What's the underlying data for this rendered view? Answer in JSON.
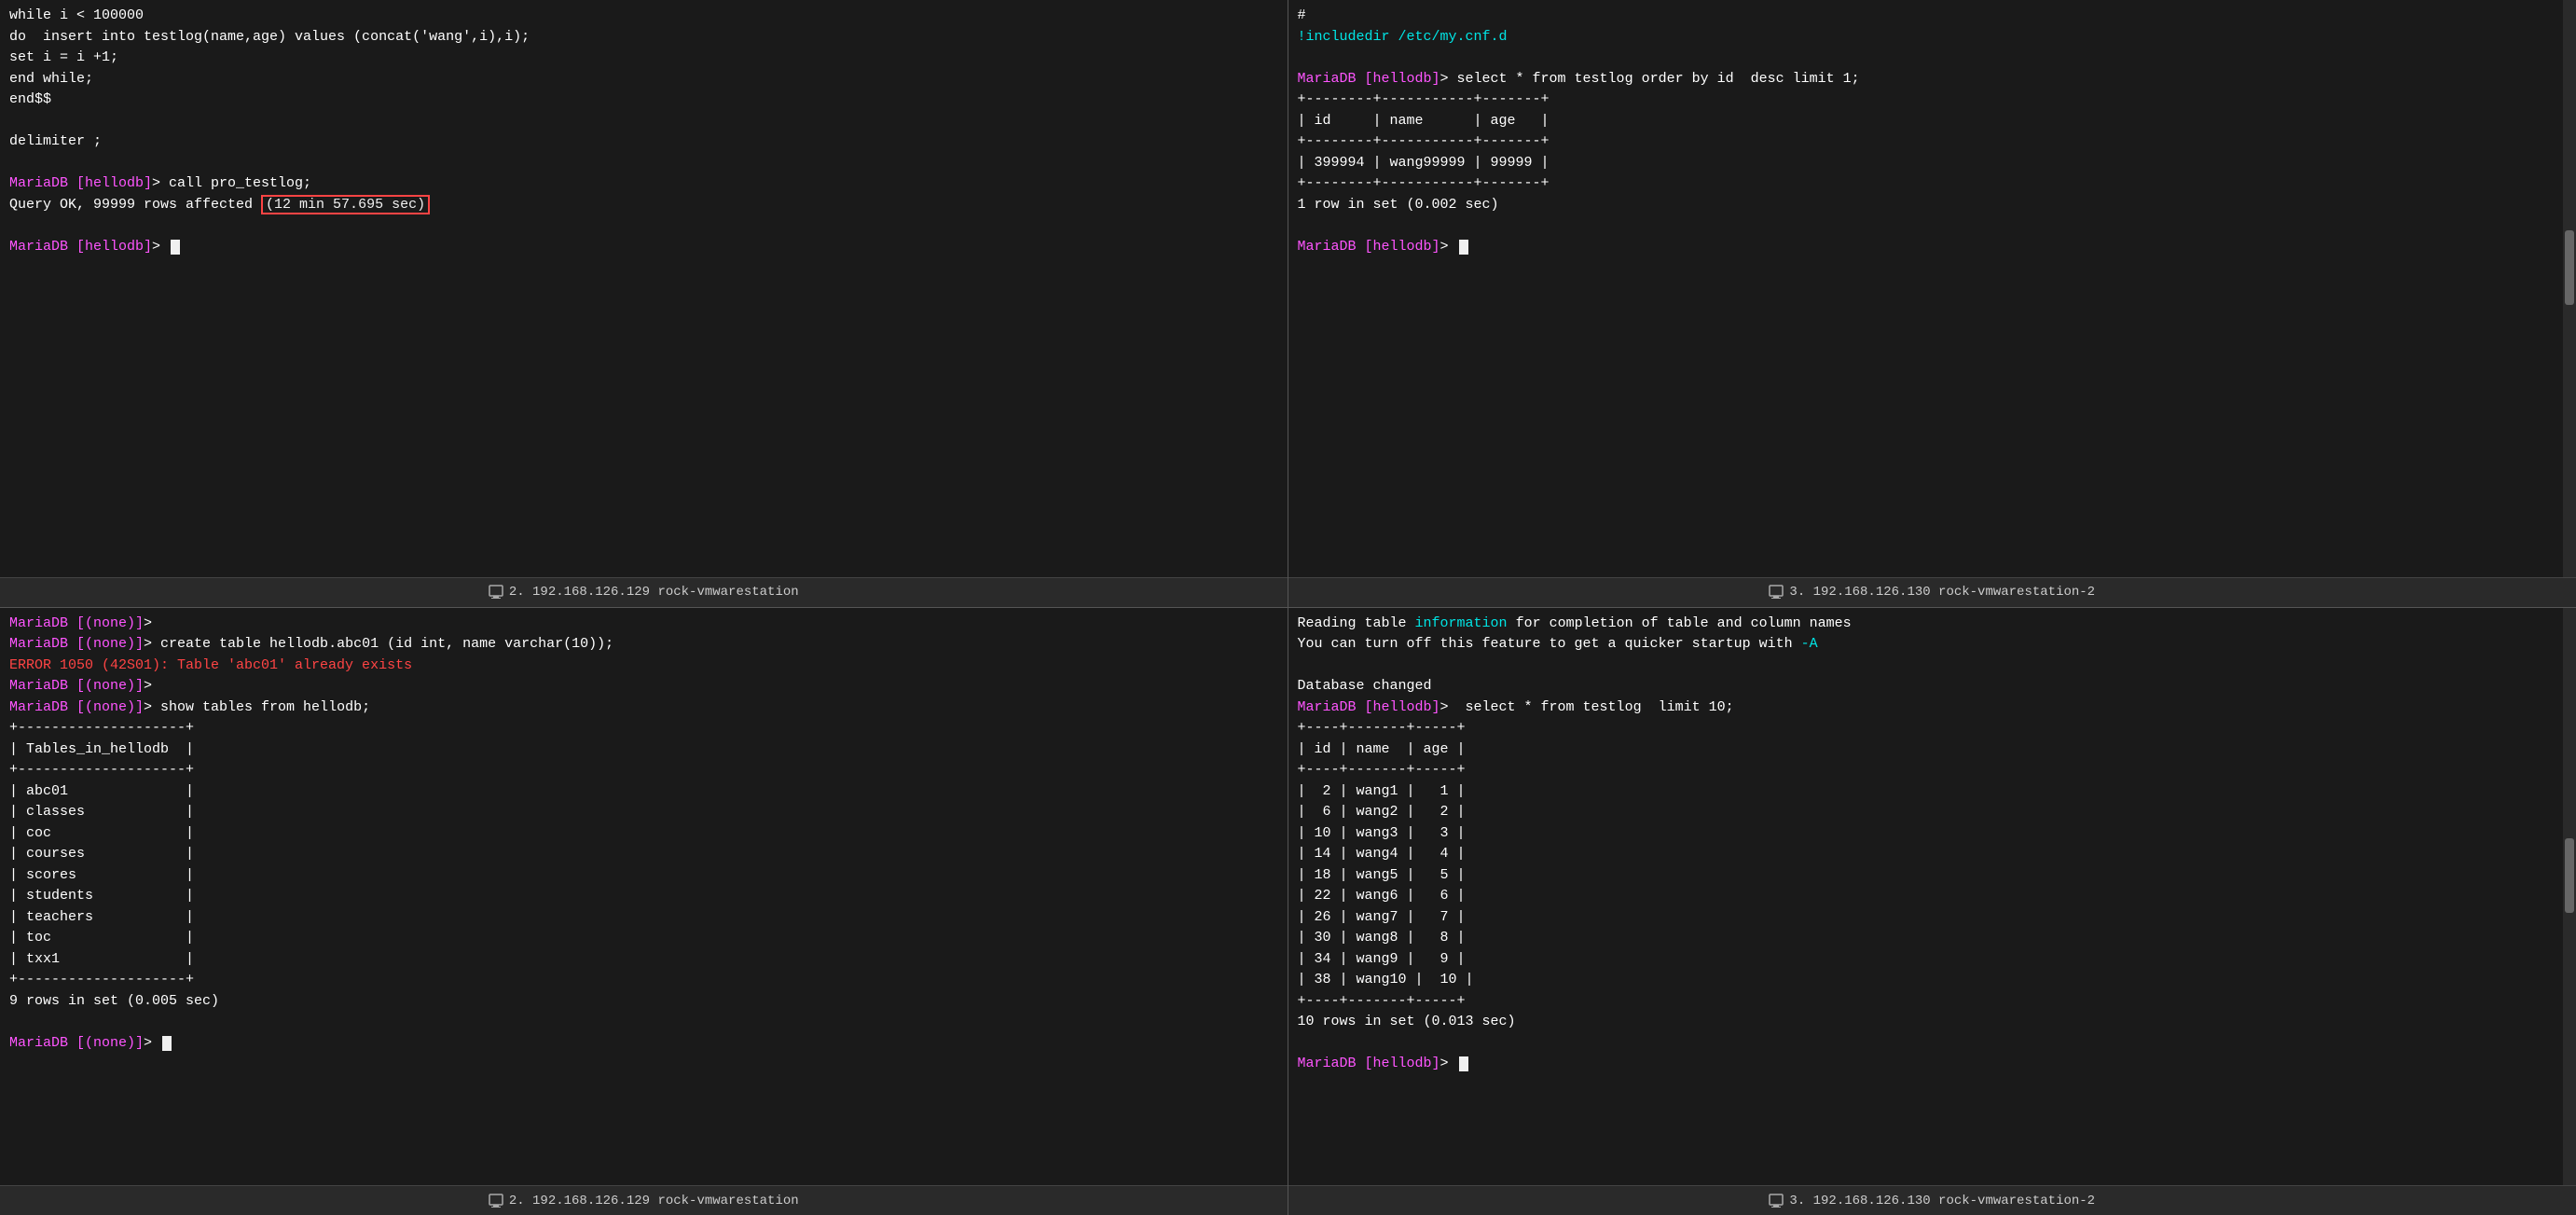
{
  "panels": {
    "top_left": {
      "tab": "2. 192.168.126.129 rock-vmwarestation",
      "content": [
        {
          "type": "normal",
          "text": "while i < 100000"
        },
        {
          "type": "normal",
          "text": "do  insert into testlog(name,age) values (concat('wang',i),i);"
        },
        {
          "type": "normal",
          "text": "set i = i +1;"
        },
        {
          "type": "normal",
          "text": "end while;"
        },
        {
          "type": "normal",
          "text": "end$$"
        },
        {
          "type": "blank"
        },
        {
          "type": "normal",
          "text": "delimiter ;"
        },
        {
          "type": "blank"
        },
        {
          "type": "prompt",
          "prompt": "MariaDB [hellodb]>",
          "cmd": " call pro_testlog;"
        },
        {
          "type": "query_ok",
          "text": "Query OK, 99999 rows affected ",
          "highlight": "(12 min 57.695 sec)"
        },
        {
          "type": "blank"
        },
        {
          "type": "prompt_cursor",
          "prompt": "MariaDB [hellodb]>"
        }
      ]
    },
    "top_right": {
      "tab": "3. 192.168.126.130 rock-vmwarestation-2",
      "content": [
        {
          "type": "normal",
          "text": "#"
        },
        {
          "type": "cyan",
          "text": "!includedir /etc/my.cnf.d"
        },
        {
          "type": "blank"
        },
        {
          "type": "prompt",
          "prompt": "MariaDB [hellodb]>",
          "cmd": " select * from testlog order by id  desc limit 1;"
        },
        {
          "type": "table_line",
          "text": "+--------+-----------+-------+"
        },
        {
          "type": "table_line",
          "text": "| id     | name      | age   |"
        },
        {
          "type": "table_line",
          "text": "+--------+-----------+-------+"
        },
        {
          "type": "table_line",
          "text": "| 399994 | wang99999 | 99999 |"
        },
        {
          "type": "table_line",
          "text": "+--------+-----------+-------+"
        },
        {
          "type": "normal",
          "text": "1 row in set (0.002 sec)"
        },
        {
          "type": "blank"
        },
        {
          "type": "prompt_cursor",
          "prompt": "MariaDB [hellodb]>"
        }
      ]
    },
    "bottom_left": {
      "tab": "2. 192.168.126.129 rock-vmwarestation",
      "content": [
        {
          "type": "prompt",
          "prompt": "MariaDB [(none)]>",
          "cmd": ""
        },
        {
          "type": "prompt",
          "prompt": "MariaDB [(none)]>",
          "cmd": " create table hellodb.abc01 (id int, name varchar(10));"
        },
        {
          "type": "error",
          "text": "ERROR 1050 (42S01): Table 'abc01' already exists"
        },
        {
          "type": "prompt",
          "prompt": "MariaDB [(none)]>",
          "cmd": ""
        },
        {
          "type": "prompt",
          "prompt": "MariaDB [(none)]>",
          "cmd": " show tables from hellodb;"
        },
        {
          "type": "table_line",
          "text": "+--------------------+"
        },
        {
          "type": "table_line",
          "text": "| Tables_in_hellodb  |"
        },
        {
          "type": "table_line",
          "text": "+--------------------+"
        },
        {
          "type": "table_row",
          "text": "| abc01              |"
        },
        {
          "type": "table_row",
          "text": "| classes            |"
        },
        {
          "type": "table_row",
          "text": "| coc                |"
        },
        {
          "type": "table_row",
          "text": "| courses            |"
        },
        {
          "type": "table_row",
          "text": "| scores             |"
        },
        {
          "type": "table_row",
          "text": "| students           |"
        },
        {
          "type": "table_row",
          "text": "| teachers           |"
        },
        {
          "type": "table_row",
          "text": "| toc                |"
        },
        {
          "type": "table_row",
          "text": "| txx1               |"
        },
        {
          "type": "table_line",
          "text": "+--------------------+"
        },
        {
          "type": "normal",
          "text": "9 rows in set (0.005 sec)"
        },
        {
          "type": "blank"
        },
        {
          "type": "prompt_cursor",
          "prompt": "MariaDB [(none)]>"
        }
      ]
    },
    "bottom_right": {
      "tab": "3. 192.168.126.130 rock-vmwarestation-2",
      "content": [
        {
          "type": "reading_info"
        },
        {
          "type": "normal",
          "text": "You can turn off this feature to get a quicker startup with "
        },
        {
          "type": "blank"
        },
        {
          "type": "normal",
          "text": "Database changed"
        },
        {
          "type": "prompt",
          "prompt": "MariaDB [hellodb]>",
          "cmd": "  select * from testlog  limit 10;"
        },
        {
          "type": "table_line",
          "text": "+----+-------+-----+"
        },
        {
          "type": "table_line",
          "text": "| id | name  | age |"
        },
        {
          "type": "table_line",
          "text": "+----+-------+-----+"
        },
        {
          "type": "table_row",
          "text": "|  2 | wang1 |   1 |"
        },
        {
          "type": "table_row",
          "text": "|  6 | wang2 |   2 |"
        },
        {
          "type": "table_row",
          "text": "| 10 | wang3 |   3 |"
        },
        {
          "type": "table_row",
          "text": "| 14 | wang4 |   4 |"
        },
        {
          "type": "table_row",
          "text": "| 18 | wang5 |   5 |"
        },
        {
          "type": "table_row",
          "text": "| 22 | wang6 |   6 |"
        },
        {
          "type": "table_row",
          "text": "| 26 | wang7 |   7 |"
        },
        {
          "type": "table_row",
          "text": "| 30 | wang8 |   8 |"
        },
        {
          "type": "table_row",
          "text": "| 34 | wang9 |   9 |"
        },
        {
          "type": "table_row",
          "text": "| 38 | wang10 |  10 |"
        },
        {
          "type": "table_line",
          "text": "+----+-------+-----+"
        },
        {
          "type": "normal",
          "text": "10 rows in set (0.013 sec)"
        },
        {
          "type": "blank"
        },
        {
          "type": "prompt_cursor",
          "prompt": "MariaDB [hellodb]>"
        }
      ]
    }
  },
  "colors": {
    "bg": "#1a1a1a",
    "panel_border": "#555555",
    "tab_bg": "#2a2a2a",
    "tab_text": "#cccccc",
    "cyan": "#00e5e5",
    "green": "#55ff55",
    "yellow": "#ffff00",
    "red": "#ff4444",
    "magenta": "#ff55ff",
    "error_red": "#ff4444",
    "highlight_border": "#ff4444"
  }
}
